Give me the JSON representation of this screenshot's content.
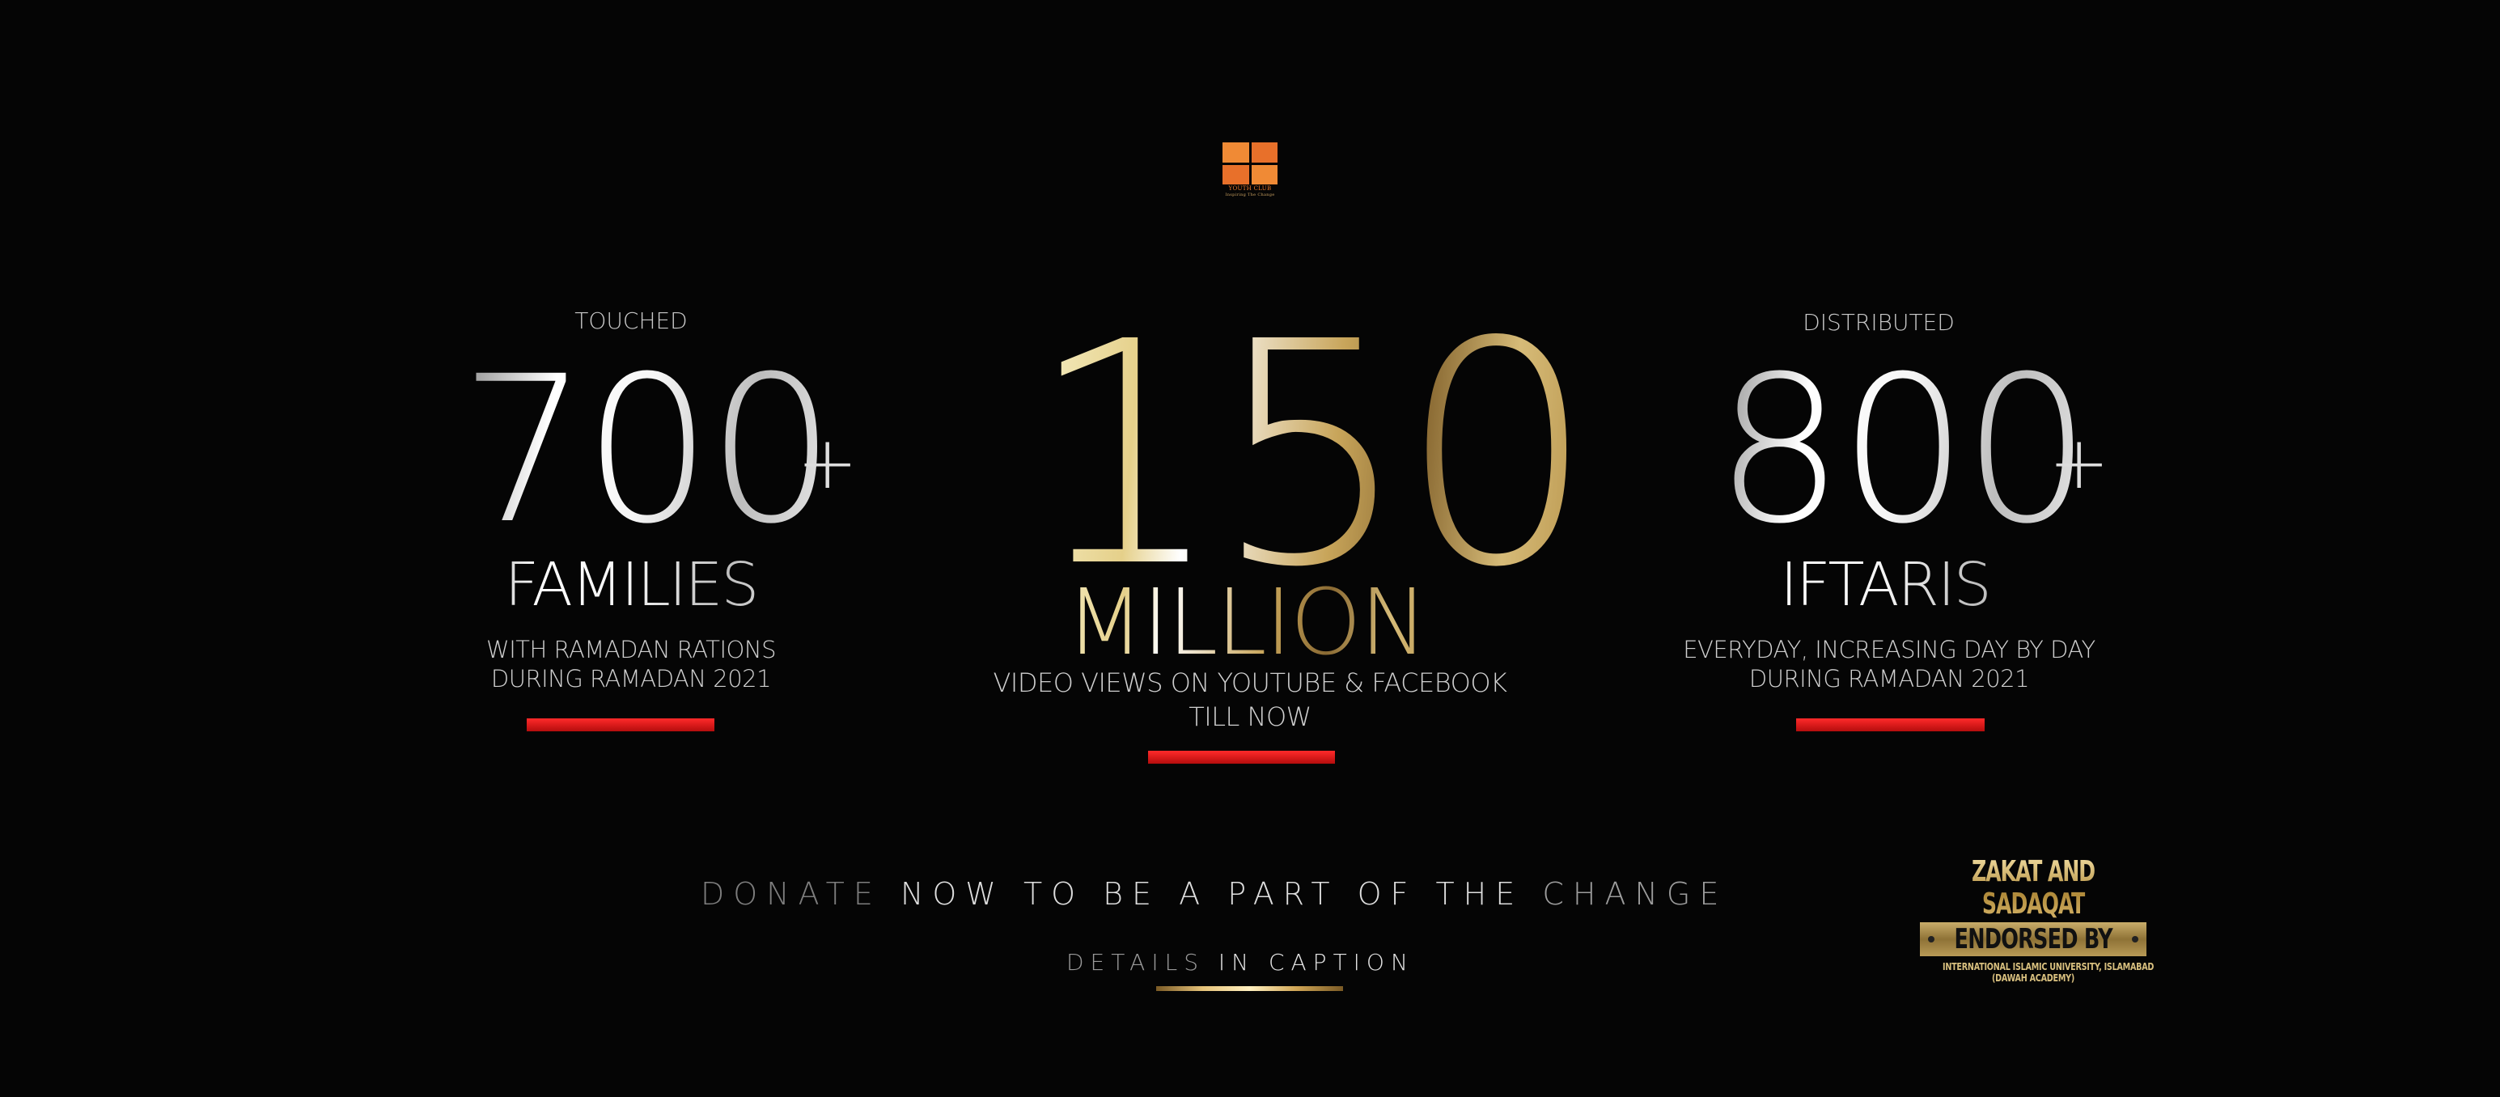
{
  "logo": {
    "caption_top": "YOUTH CLUB",
    "caption_bottom": "Inspiring The Change",
    "colors": {
      "primary": "#e8702a"
    }
  },
  "stats": {
    "left": {
      "kicker": "TOUCHED",
      "number": "700",
      "suffix": "+",
      "unit": "FAMILIES",
      "desc_line1": "WITH RAMADAN RATIONS",
      "desc_line2": "DURING RAMADAN 2021"
    },
    "center": {
      "number": "150",
      "unit": "MILLION",
      "desc_line1": "VIDEO VIEWS ON YOUTUBE & FACEBOOK",
      "desc_line2": "TILL NOW"
    },
    "right": {
      "kicker": "DISTRIBUTED",
      "number": "800",
      "suffix": "+",
      "unit": "IFTARIS",
      "desc_line1": "EVERYDAY, INCREASING DAY BY DAY",
      "desc_line2": "DURING RAMADAN 2021"
    }
  },
  "cta": {
    "word1": "DONATE",
    "word2": "NOW TO BE A PART OF THE",
    "word3": "CHANGE",
    "details_1": "DETAILS",
    "details_2": "IN CAPTION"
  },
  "badge": {
    "line1": "ZAKAT AND SADAQAT",
    "line2": "ENDORSED BY",
    "line3": "INTERNATIONAL ISLAMIC UNIVERSITY, ISLAMABAD",
    "line4": "(DAWAH ACADEMY)"
  },
  "colors": {
    "background": "#050505",
    "accent_red": "#e01414",
    "accent_gold": "#c9a55a"
  }
}
